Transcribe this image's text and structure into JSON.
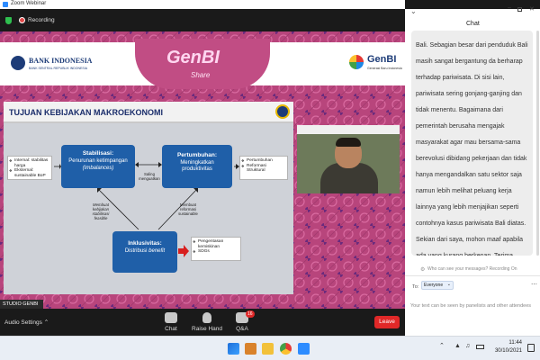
{
  "window": {
    "title": "Zoom Webinar"
  },
  "topbar": {
    "recording_label": "Recording"
  },
  "banner": {
    "bi_name": "BANK INDONESIA",
    "bi_sub": "BANK SENTRAL REPUBLIK INDONESIA",
    "genbi_logo_text": "GenBI",
    "genbi_logo_sub": "Generasi Baru Indonesia",
    "center_title": "GenBI",
    "center_sub": "Share"
  },
  "slide": {
    "title": "TUJUAN KEBIJAKAN MAKROEKONOMI",
    "stabilisasi": {
      "head": "Stabilisasi:",
      "line1": "Penurunan ketimpangan",
      "line2": "(Imbalances)"
    },
    "pertumbuhan": {
      "head": "Pertumbuhan:",
      "line1": "Meningkatkan",
      "line2": "produktivitas"
    },
    "inklusivitas": {
      "head": "Inklusivitas:",
      "line1": "Distribusi ",
      "line2": "benefit"
    },
    "left_list": [
      "Internal: stabilitas harga",
      "Eksternal: sustainable BoP"
    ],
    "right_list": [
      "Pertumbuhan",
      "Reformasi Struktural"
    ],
    "bottom_list": [
      "Pengentasan kemiskinan",
      "SDGs"
    ],
    "arrow_saling": "Saling menguatkan",
    "arrow_left": "Membuat kebijakan stabilisasi feasible",
    "arrow_right": "Membuat reformasi sustainable"
  },
  "studio_label": "STUDIO GENBI",
  "bottom": {
    "audio_settings": "Audio Settings",
    "chat": "Chat",
    "raise_hand": "Raise Hand",
    "qa": "Q&A",
    "qa_badge": "16",
    "leave": "Leave"
  },
  "chat_panel": {
    "title": "Chat",
    "message": "Bali. Sebagian besar dari penduduk Bali masih sangat bergantung da berharap terhadap pariwisata. Di sisi lain, pariwisata sering gonjang-ganjing dan tidak menentu. Bagaimana dari pemerintah berusaha mengajak masyarakat agar mau bersama-sama berevolusi dibidang pekerjaan dan tidak hanya mengandalkan satu sektor saja namun lebih melihat peluang kerja lainnya yang lebih menjajikan seperti contohnya kasus pariwisata Bali diatas. Sekian dari saya, mohon maaf apabila ada yang kurang berkenan. Terima kasih",
    "privacy_link": "Who can see your messages? Recording On",
    "to_label": "To:",
    "to_value": "Everyone",
    "input_placeholder": "Your text can be seen by panelists and other attendees"
  },
  "taskbar": {
    "time": "11:44",
    "date": "30/10/2021"
  },
  "colors": {
    "accent_blue": "#1f5fa8",
    "leave_red": "#e02828",
    "slide_pink": "#c14d84"
  }
}
